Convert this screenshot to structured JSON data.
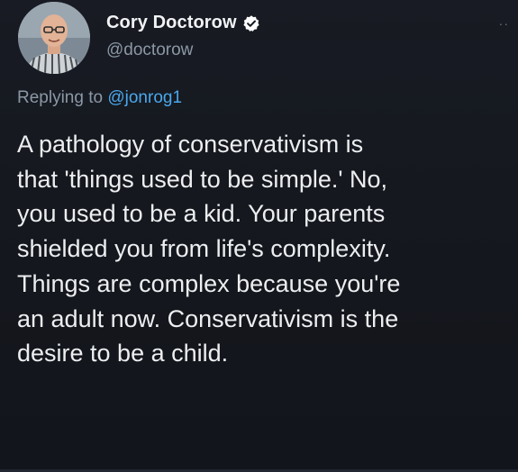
{
  "author": {
    "display_name": "Cory Doctorow",
    "handle": "@doctorow",
    "verified_icon": "verified-badge-icon",
    "avatar_icon": "profile-avatar"
  },
  "reply": {
    "prefix": "Replying to ",
    "target": "@jonrog1"
  },
  "tweet": {
    "lines": [
      "A pathology of conservativism is",
      "that 'things used to be simple.' No,",
      "you used to be a kid. Your parents",
      "shielded you from life's complexity.",
      "Things are complex because you're",
      "an adult now. Conservativism is the",
      "desire to be a child."
    ]
  },
  "more_icon_glyph": "··",
  "colors": {
    "background": "#15181f",
    "text": "#e7e9ea",
    "secondary": "#8b98a5",
    "link": "#4aa8ec"
  }
}
